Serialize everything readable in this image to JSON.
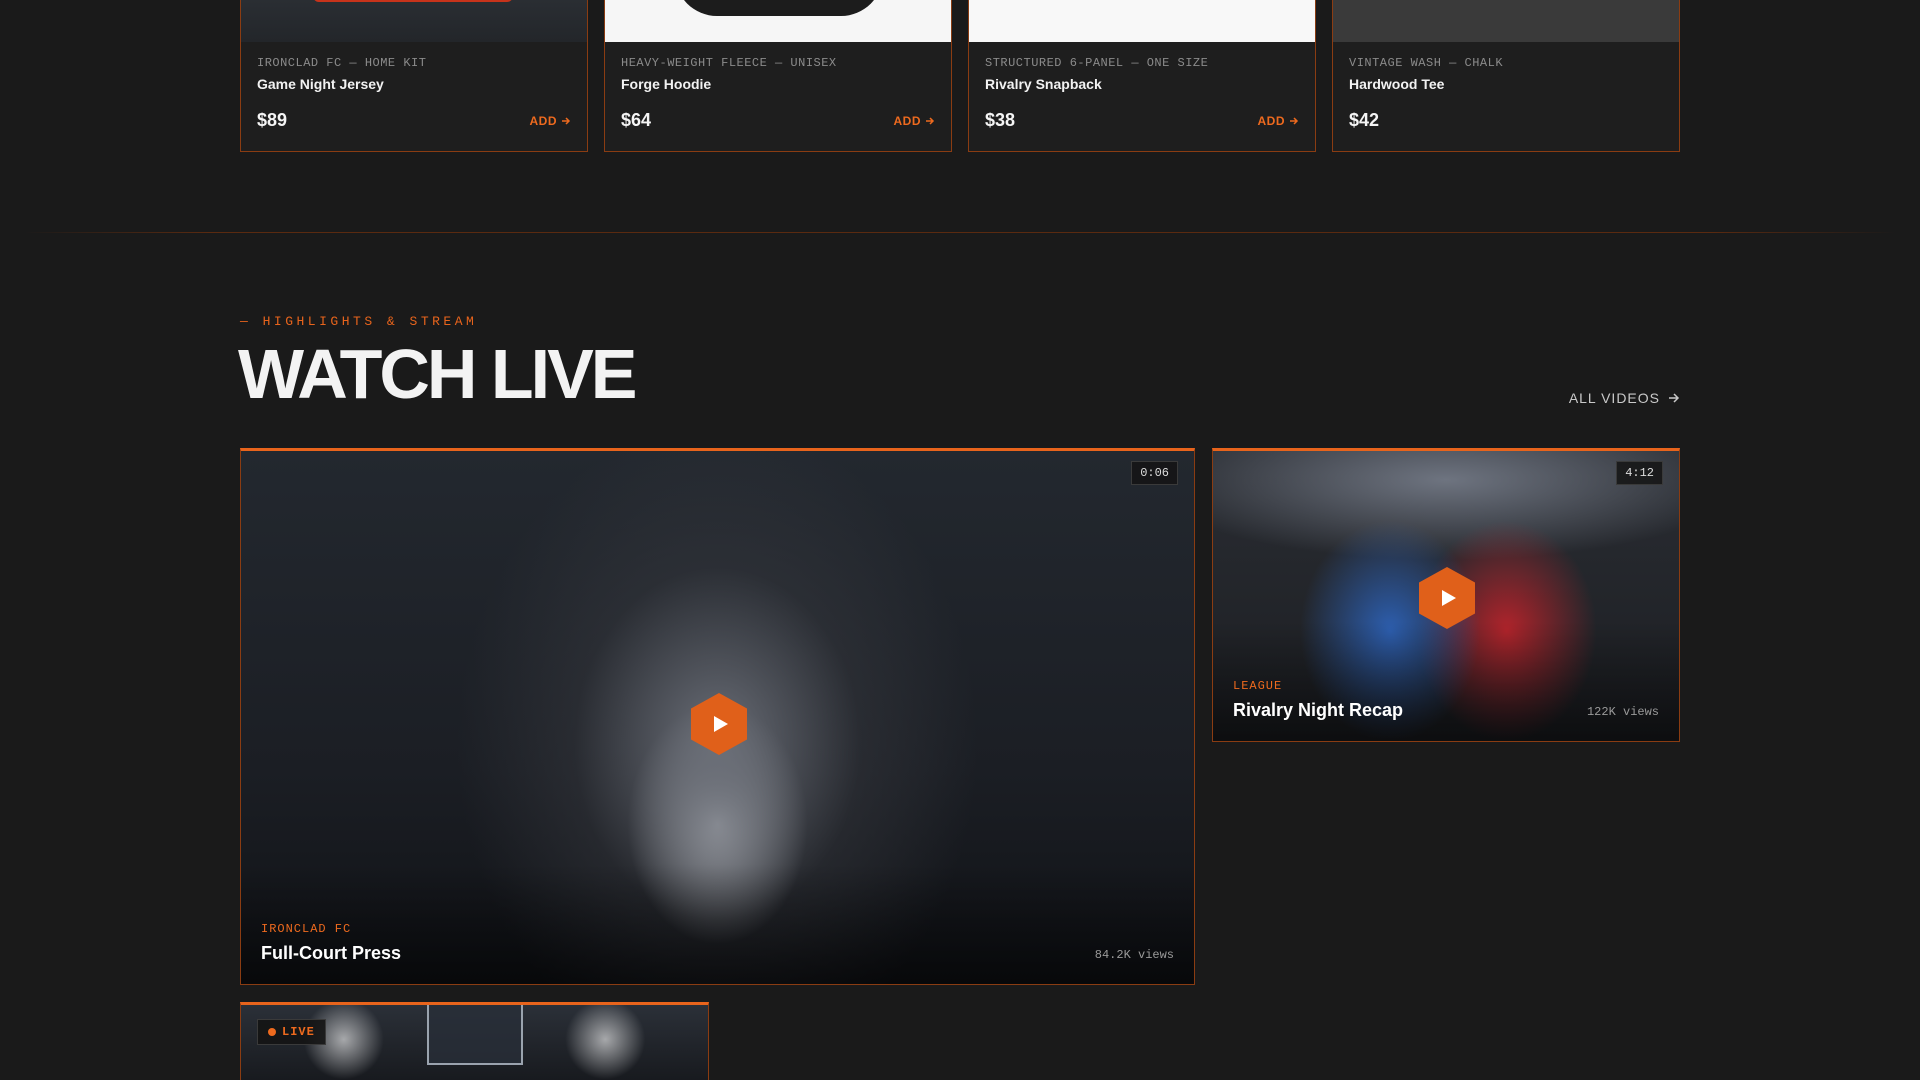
{
  "products": [
    {
      "meta": "IRONCLAD FC — HOME KIT",
      "name": "Game Night Jersey",
      "price": "$89",
      "add_label": "ADD"
    },
    {
      "meta": "HEAVY-WEIGHT FLEECE — UNISEX",
      "name": "Forge Hoodie",
      "price": "$64",
      "add_label": "ADD"
    },
    {
      "meta": "STRUCTURED 6-PANEL — ONE SIZE",
      "name": "Rivalry Snapback",
      "price": "$38",
      "add_label": "ADD"
    },
    {
      "meta": "VINTAGE WASH — CHALK",
      "name": "Hardwood Tee",
      "price": "$42"
    }
  ],
  "section": {
    "eyebrow": "— HIGHLIGHTS & STREAM",
    "title": "WATCH LIVE",
    "all_videos_label": "ALL VIDEOS"
  },
  "videos": {
    "main": {
      "duration": "0:06",
      "league": "IRONCLAD FC",
      "title": "Full-Court Press",
      "views": "84.2K views"
    },
    "side": {
      "duration": "4:12",
      "league": "LEAGUE",
      "title": "Rivalry Night Recap",
      "views": "122K views"
    },
    "live": {
      "badge": "LIVE"
    }
  },
  "colors": {
    "accent": "#e8641c",
    "background": "#1a1a1a",
    "card_border": "#8a3c12"
  },
  "icons": {
    "add": "arrow-right-icon",
    "all_videos": "arrow-right-icon",
    "play": "play-icon",
    "live": "live-dot-icon"
  }
}
